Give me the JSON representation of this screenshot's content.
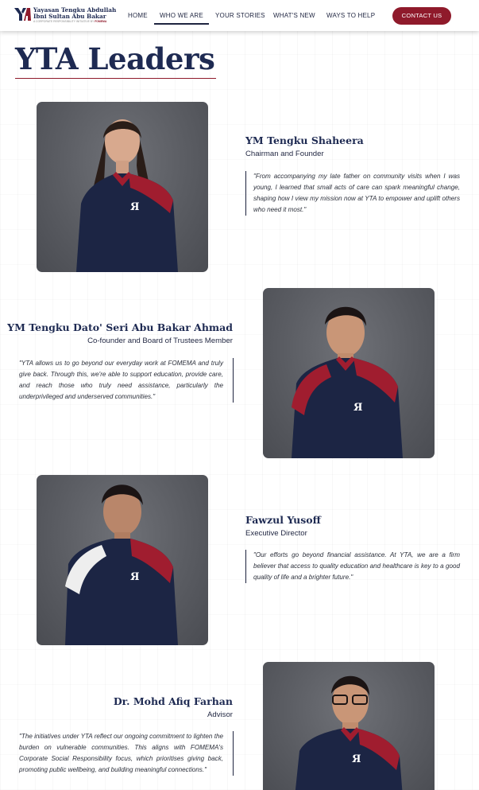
{
  "nav": {
    "logo": {
      "line1": "Yayasan Tengku Abdullah",
      "line2": "Ibni Sultan Abu Bakar",
      "tagline": "A CORPORATE RESPONSIBILITY INITIATIVE BY",
      "tagline_brand": "FOMEMA"
    },
    "items": [
      {
        "label": "HOME"
      },
      {
        "label": "WHO WE ARE"
      },
      {
        "label": "YOUR STORIES"
      },
      {
        "label": "WHAT'S NEW"
      },
      {
        "label": "WAYS TO HELP"
      }
    ],
    "active_item": "WHO WE ARE",
    "contact_label": "CONTACT US"
  },
  "page": {
    "title": "YTA Leaders"
  },
  "leaders": [
    {
      "name": "YM Tengku Shaheera",
      "role": "Chairman and Founder",
      "quote": "\"From accompanying my late father on community visits when I was young, I learned that small acts of care can spark meaningful change, shaping how I view my mission now at YTA to empower and uplift others who need it most.\""
    },
    {
      "name": "YM Tengku Dato' Seri Abu Bakar Ahmad",
      "role": "Co-founder and Board of Trustees Member",
      "quote": "\"YTA allows us to go beyond our everyday work at FOMEMA and truly give back. Through this, we're able to support education, provide care, and reach those who truly need assistance, particularly the underprivileged and underserved communities.\""
    },
    {
      "name": "Fawzul Yusoff",
      "role": "Executive Director",
      "quote": "\"Our efforts go beyond financial assistance. At YTA, we are a firm believer that access to quality education and healthcare is key to a good quality of life and a brighter future.\""
    },
    {
      "name": "Dr. Mohd Afiq Farhan",
      "role": "Advisor",
      "quote": "\"The initiatives under YTA reflect our ongoing commitment to lighten the burden on vulnerable communities. This aligns with FOMEMA's Corporate Social Responsibility focus, which prioritises giving back, promoting public wellbeing, and building meaningful connections.\""
    }
  ],
  "colors": {
    "navy": "#1e2a52",
    "maroon": "#8f1a2b",
    "photo_bg": "#5a5c62"
  }
}
